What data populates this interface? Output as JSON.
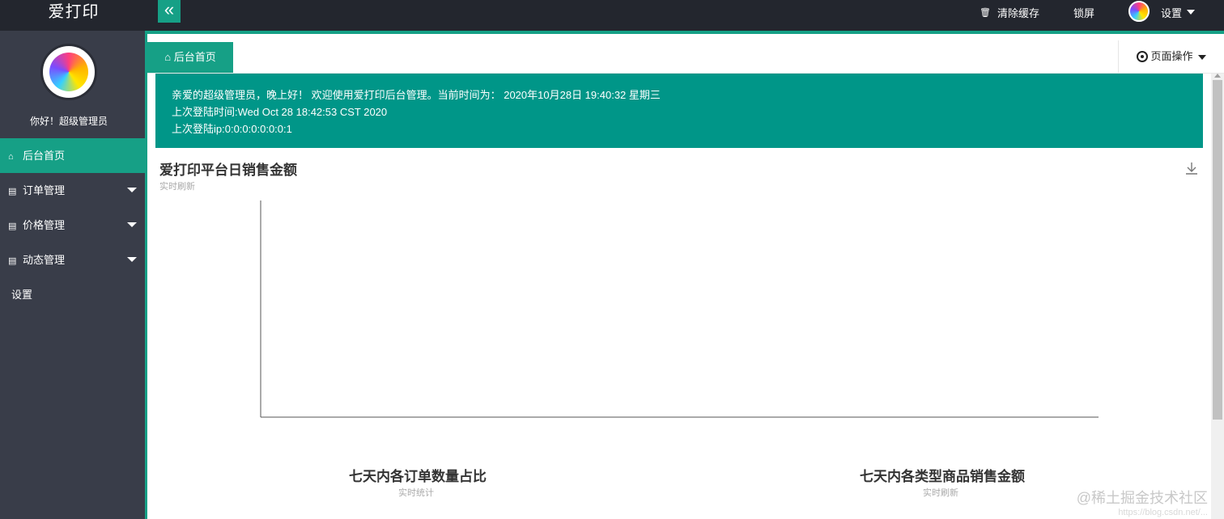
{
  "app": {
    "title": "爱打印"
  },
  "header": {
    "toggle_icon": "double-chevron-left-icon",
    "clear_cache": "清除缓存",
    "lock_screen": "锁屏",
    "settings": "设置"
  },
  "sidebar": {
    "greeting": "你好！超级管理员",
    "items": [
      {
        "label": "后台首页",
        "icon": "home-icon"
      },
      {
        "label": "订单管理",
        "icon": "list-icon"
      },
      {
        "label": "价格管理",
        "icon": "list-icon"
      },
      {
        "label": "动态管理",
        "icon": "list-icon"
      },
      {
        "label": "设置"
      }
    ]
  },
  "tabs": {
    "home": "后台首页",
    "page_ops": "页面操作"
  },
  "welcome": {
    "line1": "亲爱的超级管理员，晚上好！ 欢迎使用爱打印后台管理。当前时间为： 2020年10月28日 19:40:32   星期三",
    "line2": "上次登陆时间:Wed Oct 28 18:42:53 CST 2020",
    "line3": "上次登陆ip:0:0:0:0:0:0:0:1"
  },
  "charts": {
    "daily": {
      "title": "爱打印平台日销售金额",
      "subtitle": "实时刷新"
    },
    "orders": {
      "title": "七天内各订单数量占比",
      "subtitle": "实时统计"
    },
    "categories": {
      "title": "七天内各类型商品销售金额",
      "subtitle": "实时刷新"
    }
  },
  "chart_data": {
    "type": "line",
    "title": "爱打印平台日销售金额",
    "subtitle": "实时刷新",
    "series": [],
    "grid": false
  },
  "watermark": {
    "text": "@稀土掘金技术社区",
    "url": "https://blog.csdn.net/..."
  },
  "colors": {
    "accent": "#16a086",
    "header_bg": "#23262e",
    "sidebar_bg": "#393d49",
    "welcome_bg": "#009688"
  }
}
